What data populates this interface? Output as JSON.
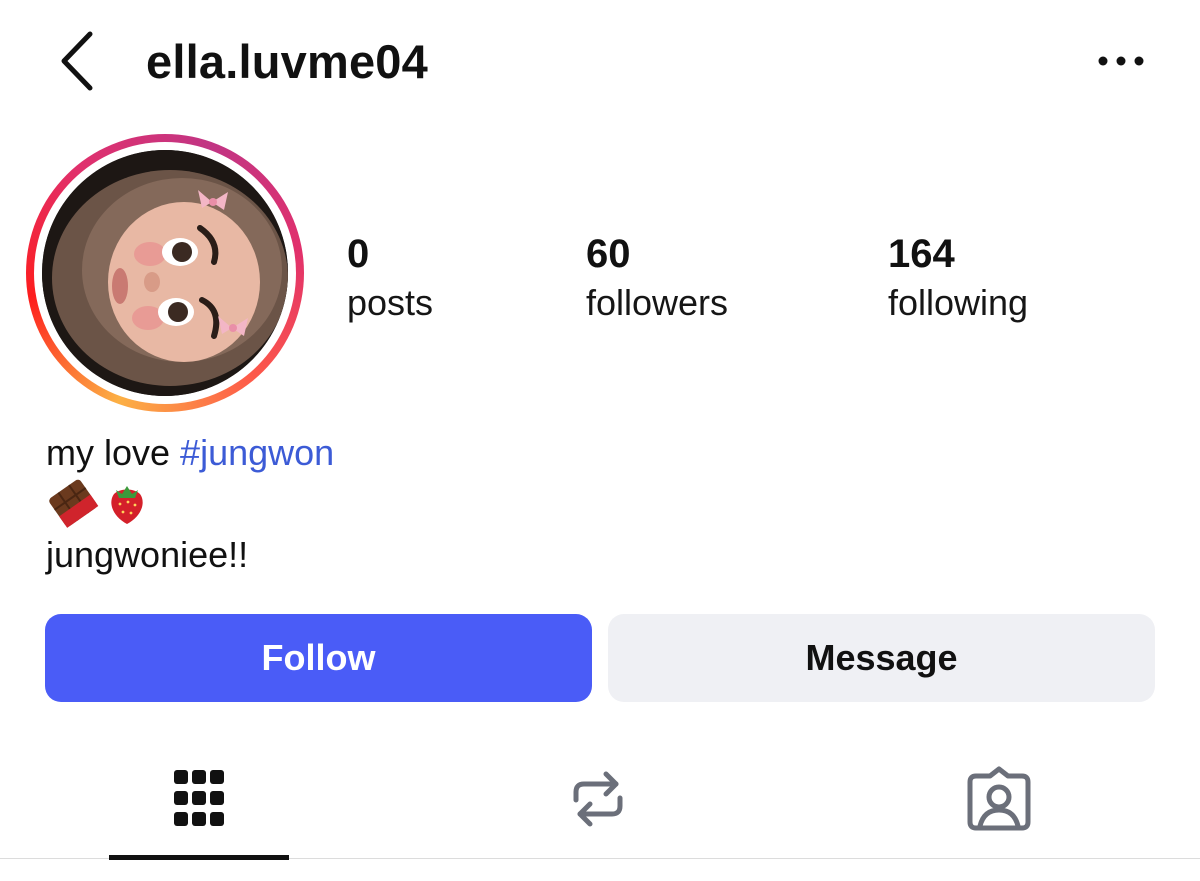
{
  "header": {
    "username": "ella.luvme04",
    "back_icon": "chevron-left-icon",
    "more_icon": "more-horizontal-icon"
  },
  "profile": {
    "avatar_ring_colors": [
      "#fcb045",
      "#fd1d1d",
      "#e1306c",
      "#c13584"
    ],
    "stats": {
      "posts": {
        "count": "0",
        "label": "posts"
      },
      "followers": {
        "count": "60",
        "label": "followers"
      },
      "following": {
        "count": "164",
        "label": "following"
      }
    }
  },
  "bio": {
    "line1_text": "my love ",
    "hashtag": "#jungwon",
    "emojis": [
      "chocolate-bar-icon",
      "strawberry-icon"
    ],
    "line3": "jungwoniee!!"
  },
  "actions": {
    "follow_label": "Follow",
    "message_label": "Message",
    "follow_color": "#4a5cf7",
    "message_color": "#eff0f4"
  },
  "tabs": [
    {
      "icon": "grid-icon",
      "active": true
    },
    {
      "icon": "repost-icon",
      "active": false
    },
    {
      "icon": "tagged-user-icon",
      "active": false
    }
  ],
  "colors": {
    "hashtag": "#3c5bd6"
  }
}
